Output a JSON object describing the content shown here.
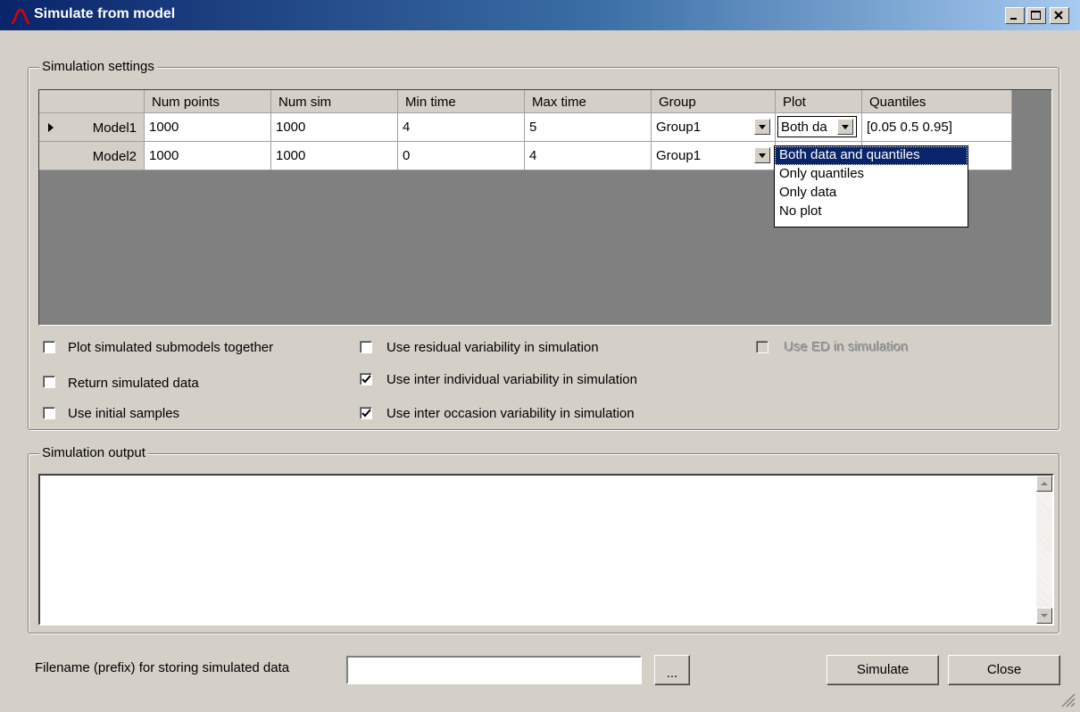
{
  "window": {
    "title": "Simulate from model"
  },
  "settings": {
    "label": "Simulation settings",
    "columns": [
      "Num points",
      "Num sim",
      "Min time",
      "Max time",
      "Group",
      "Plot",
      "Quantiles"
    ],
    "rows": [
      {
        "name": "Model1",
        "num_points": "1000",
        "num_sim": "1000",
        "min_time": "4",
        "max_time": "5",
        "group": "Group1",
        "plot": "Both da",
        "quantiles": "[0.05 0.5 0.95]",
        "current": true
      },
      {
        "name": "Model2",
        "num_points": "1000",
        "num_sim": "1000",
        "min_time": "0",
        "max_time": "4",
        "group": "Group1"
      }
    ],
    "plot_options": [
      "Both data and quantiles",
      "Only quantiles",
      "Only data",
      "No plot"
    ],
    "plot_selected_index": 0
  },
  "options": [
    {
      "label": "Plot simulated submodels together",
      "checked": false,
      "enabled": true
    },
    {
      "label": "Return simulated data",
      "checked": false,
      "enabled": true
    },
    {
      "label": "Use initial samples",
      "checked": false,
      "enabled": true
    },
    {
      "label": "Use residual variability in simulation",
      "checked": false,
      "enabled": true
    },
    {
      "label": "Use inter individual variability in simulation",
      "checked": true,
      "enabled": true
    },
    {
      "label": "Use inter occasion variability in simulation",
      "checked": true,
      "enabled": true
    },
    {
      "label": "Use ED in simulation",
      "checked": false,
      "enabled": false
    }
  ],
  "output": {
    "label": "Simulation output",
    "text": ""
  },
  "footer": {
    "filename_label": "Filename (prefix) for storing simulated data",
    "filename_value": "",
    "browse_label": "...",
    "simulate_label": "Simulate",
    "close_label": "Close"
  },
  "colors": {
    "titlebar_start": "#0a246a",
    "titlebar_end": "#a6caf0",
    "selection": "#0a246a",
    "face": "#d4d0c8"
  }
}
